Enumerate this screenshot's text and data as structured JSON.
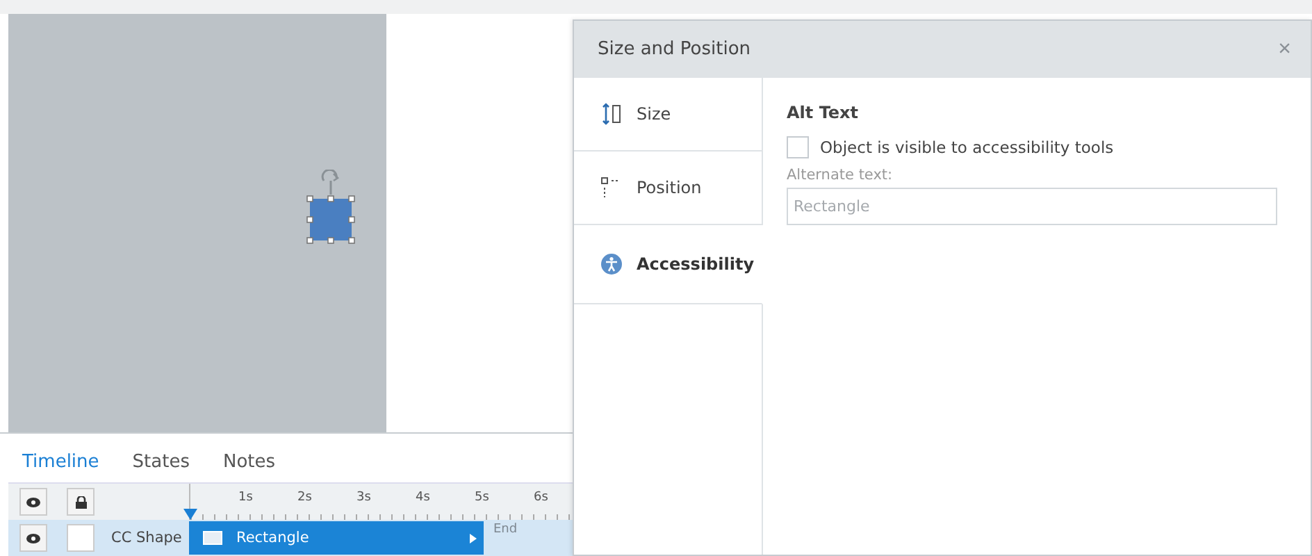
{
  "dialog": {
    "title": "Size and Position",
    "close": "×",
    "tabs": [
      {
        "label": "Size",
        "kind": "size",
        "selected": false
      },
      {
        "label": "Position",
        "kind": "position",
        "selected": false
      },
      {
        "label": "Accessibility",
        "kind": "accessibility",
        "selected": true
      }
    ],
    "section_title": "Alt Text",
    "checkbox": {
      "label": "Object is visible to accessibility tools",
      "checked": false
    },
    "field": {
      "label": "Alternate text:",
      "value": "Rectangle",
      "disabled": true
    }
  },
  "panel": {
    "tabs": [
      {
        "label": "Timeline",
        "selected": true
      },
      {
        "label": "States",
        "selected": false
      },
      {
        "label": "Notes",
        "selected": false
      }
    ],
    "ruler": [
      "1s",
      "2s",
      "3s",
      "4s",
      "5s",
      "6s"
    ],
    "layers": [
      {
        "name": "CC Shape",
        "clip": "Rectangle",
        "end": "End",
        "selected": true
      }
    ]
  }
}
